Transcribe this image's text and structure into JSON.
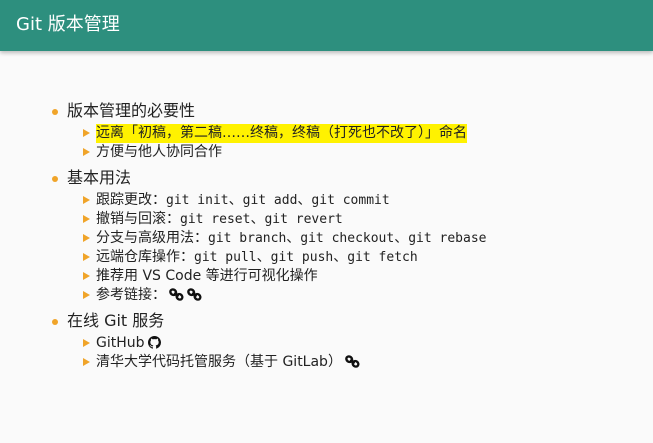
{
  "header": {
    "title": "Git 版本管理"
  },
  "sections": [
    {
      "label": "版本管理的必要性",
      "items": [
        {
          "text": "远离「初稿，第二稿……终稿，终稿（打死也不改了）」命名"
        },
        {
          "text": "方便与他人协同合作"
        }
      ]
    },
    {
      "label": "基本用法",
      "items": [
        {
          "prefix": "跟踪更改：",
          "cmds": [
            "git init",
            "git add",
            "git commit"
          ]
        },
        {
          "prefix": "撤销与回滚：",
          "cmds": [
            "git reset",
            "git revert"
          ]
        },
        {
          "prefix": "分支与高级用法：",
          "cmds": [
            "git branch",
            "git checkout",
            "git rebase"
          ]
        },
        {
          "prefix": "远端仓库操作：",
          "cmds": [
            "git pull",
            "git push",
            "git fetch"
          ]
        },
        {
          "text": "推荐用 VS Code 等进行可视化操作"
        },
        {
          "prefix": "参考链接：",
          "icons": [
            "link-icon",
            "link-icon"
          ]
        }
      ]
    },
    {
      "label": "在线 Git 服务",
      "items": [
        {
          "text": "GitHub",
          "icons": [
            "github-icon"
          ]
        },
        {
          "text": "清华大学代码托管服务（基于 GitLab）",
          "icons": [
            "link-icon"
          ]
        }
      ]
    }
  ],
  "separator": "、",
  "colors": {
    "header_bg": "#2d8f7e",
    "bullet": "#f0a429",
    "highlight": "#fff200"
  }
}
